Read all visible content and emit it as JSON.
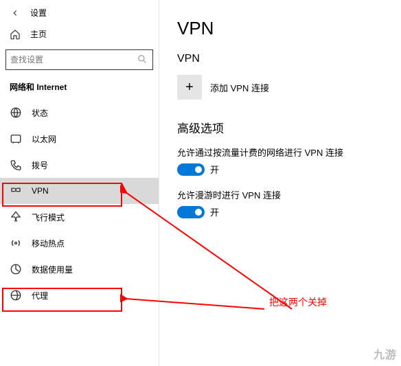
{
  "titlebar": {
    "title": "设置"
  },
  "home": {
    "label": "主页"
  },
  "search": {
    "placeholder": "查找设置"
  },
  "category": "网络和 Internet",
  "nav": {
    "items": [
      {
        "label": "状态"
      },
      {
        "label": "以太网"
      },
      {
        "label": "拨号"
      },
      {
        "label": "VPN"
      },
      {
        "label": "飞行模式"
      },
      {
        "label": "移动热点"
      },
      {
        "label": "数据使用量"
      },
      {
        "label": "代理"
      }
    ]
  },
  "main": {
    "title": "VPN",
    "subtitle": "VPN",
    "add_label": "添加 VPN 连接",
    "advanced": "高级选项",
    "options": [
      {
        "label": "允许通过按流量计费的网络进行 VPN 连接",
        "state": "开"
      },
      {
        "label": "允许漫游时进行 VPN 连接",
        "state": "开"
      }
    ]
  },
  "annotation": "把这两个关掉",
  "watermark": "九游"
}
